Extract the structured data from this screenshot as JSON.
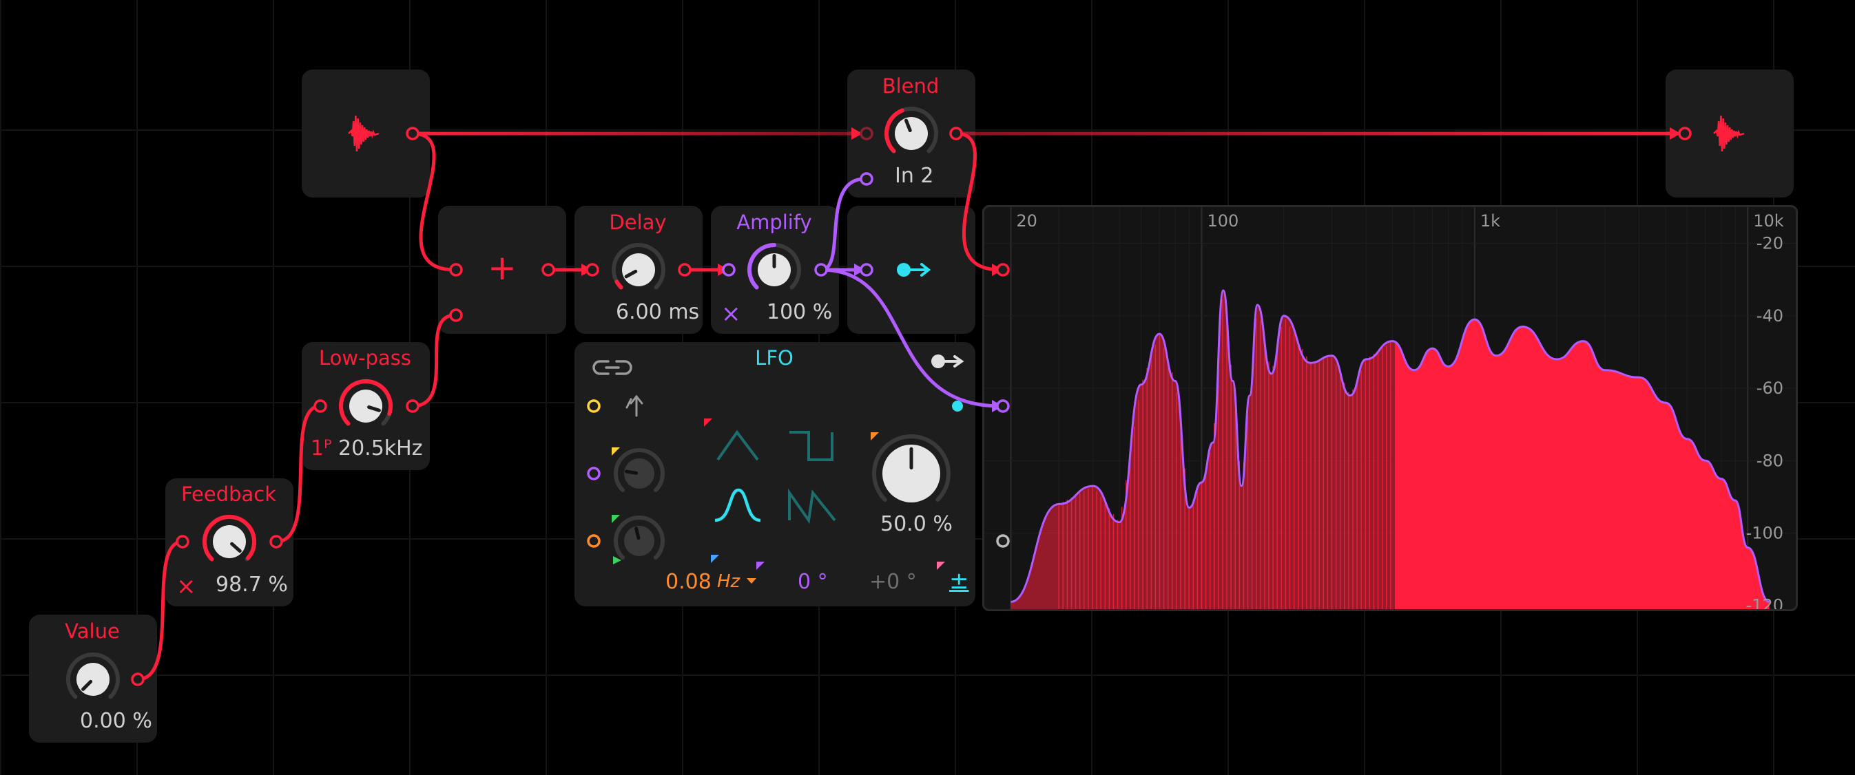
{
  "colors": {
    "red": "#ff1f3c",
    "purple": "#b15cff",
    "cyan": "#2fe0f0",
    "orange": "#ff8a2a",
    "yellow": "#ffd43b",
    "green": "#3ad25c",
    "tile_bg": "#1d1d1d"
  },
  "modules": {
    "value": {
      "title": "Value",
      "readout": "0.00 %"
    },
    "feedback": {
      "title": "Feedback",
      "readout": "98.7 %",
      "mute_glyph": "×"
    },
    "lowpass": {
      "title": "Low-pass",
      "order": "1ᴾ",
      "readout": "20.5kHz"
    },
    "input": {
      "icon": "audio-wave-icon"
    },
    "sum": {
      "glyph": "+"
    },
    "delay": {
      "title": "Delay",
      "readout": "6.00 ms"
    },
    "amplify": {
      "title": "Amplify",
      "readout": "100 %",
      "mute_glyph": "×"
    },
    "blend": {
      "title": "Blend",
      "readout": "In 2"
    },
    "output_route": {
      "icon": "route-arrow-icon"
    },
    "lfo": {
      "title": "LFO",
      "rate_value": "0.08",
      "rate_unit": "Hz",
      "phase": "0 °",
      "phase_offset": "+0 °",
      "depth": "50.0 %",
      "bipolar": "±",
      "shapes": [
        "triangle",
        "square",
        "sine",
        "saw"
      ],
      "selected_shape": "sine"
    },
    "output": {
      "icon": "audio-wave-icon"
    }
  },
  "chart_data": {
    "type": "area",
    "title": "",
    "xscale": "log",
    "x_ticks": [
      "20",
      "100",
      "1k",
      "10k"
    ],
    "y_ticks": [
      "-20",
      "-40",
      "-60",
      "-80",
      "-100",
      "-120"
    ],
    "xlim": [
      16,
      15000
    ],
    "ylim": [
      -121,
      -10
    ],
    "grid": true,
    "x": [
      20,
      30,
      40,
      50,
      60,
      70,
      80,
      90,
      100,
      110,
      120,
      130,
      140,
      150,
      160,
      180,
      200,
      250,
      300,
      350,
      400,
      500,
      600,
      700,
      800,
      1000,
      1200,
      1500,
      2000,
      2500,
      3000,
      4000,
      5000,
      6000,
      7000,
      8000,
      9000,
      10000,
      12000
    ],
    "series": [
      {
        "values": [
          -119,
          -92,
          -87,
          -97,
          -59,
          -45,
          -58,
          -93,
          -86,
          -75,
          -33,
          -58,
          -87,
          -62,
          -37,
          -56,
          -40,
          -53,
          -51,
          -62,
          -52,
          -47,
          -55,
          -49,
          -54,
          -41,
          -51,
          -43,
          -52,
          -47,
          -55,
          -57,
          -64,
          -74,
          -80,
          -85,
          -91,
          -104,
          -119
        ]
      }
    ]
  }
}
